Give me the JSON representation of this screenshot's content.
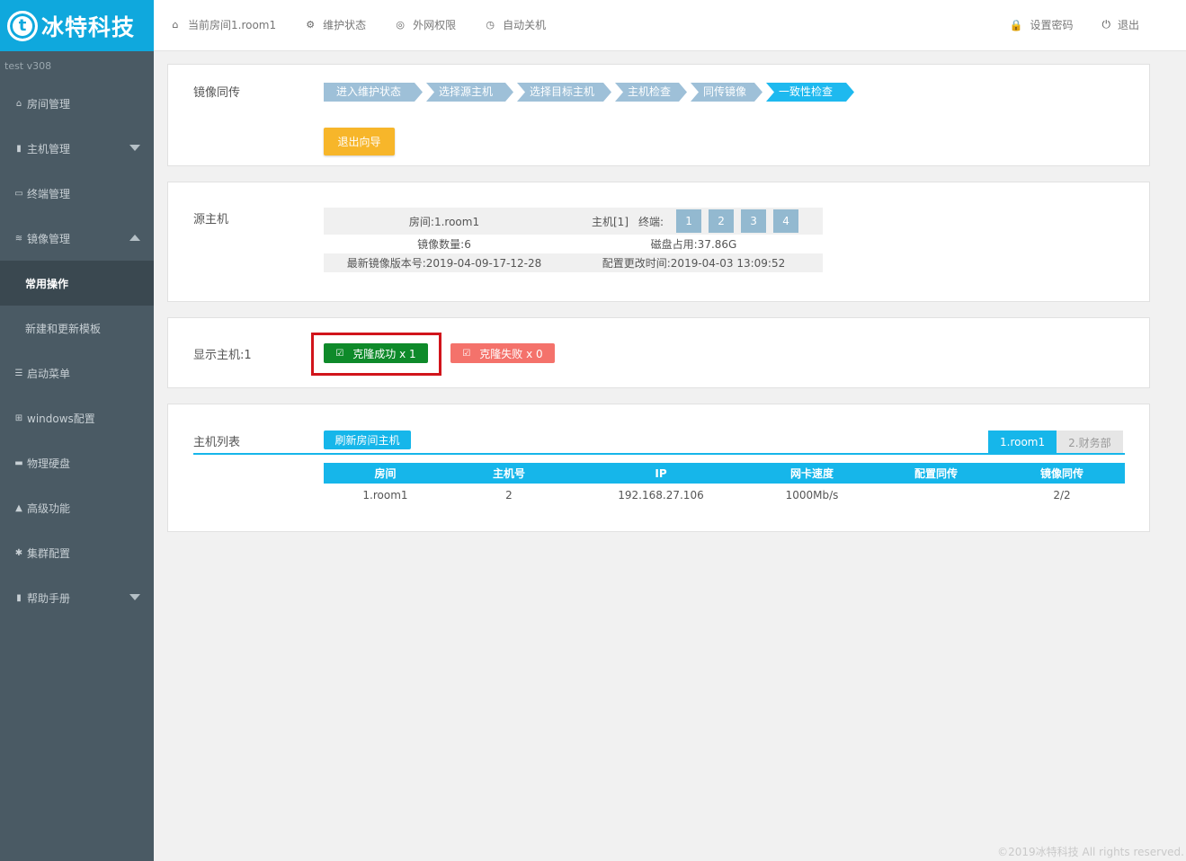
{
  "brand": {
    "logo_letter": "t",
    "name": "冰特科技"
  },
  "topnav": [
    {
      "icon": "home-icon",
      "glyph": "⌂",
      "label": "当前房间1.room1"
    },
    {
      "icon": "wrench-icon",
      "glyph": "⚙",
      "label": "维护状态"
    },
    {
      "icon": "globe-icon",
      "glyph": "◎",
      "label": "外网权限"
    },
    {
      "icon": "clock-icon",
      "glyph": "◷",
      "label": "自动关机"
    }
  ],
  "topright": [
    {
      "icon": "lock-icon",
      "glyph": "🔒",
      "label": "设置密码"
    },
    {
      "icon": "power-icon",
      "glyph": "⏻",
      "label": "退出"
    }
  ],
  "sidebar": {
    "version": "test  v308",
    "items": [
      {
        "label": "房间管理",
        "icon": "home-icon",
        "glyph": "⌂"
      },
      {
        "label": "主机管理",
        "icon": "server-icon",
        "glyph": "▮"
      },
      {
        "label": "终端管理",
        "icon": "monitor-icon",
        "glyph": "▭"
      },
      {
        "label": "镜像管理",
        "icon": "database-icon",
        "glyph": "≋"
      },
      {
        "label": "常用操作"
      },
      {
        "label": "新建和更新模板"
      },
      {
        "label": "启动菜单",
        "icon": "list-icon",
        "glyph": "☰"
      },
      {
        "label": "windows配置",
        "icon": "windows-icon",
        "glyph": "⊞"
      },
      {
        "label": "物理硬盘",
        "icon": "harddisk-icon",
        "glyph": "▬"
      },
      {
        "label": "高级功能",
        "icon": "warning-icon",
        "glyph": "▲"
      },
      {
        "label": "集群配置",
        "icon": "gear-icon",
        "glyph": "✱"
      },
      {
        "label": "帮助手册",
        "icon": "book-icon",
        "glyph": "▮"
      }
    ]
  },
  "wizard": {
    "title": "镜像同传",
    "steps": [
      "进入维护状态",
      "选择源主机",
      "选择目标主机",
      "主机检查",
      "同传镜像",
      "一致性检查"
    ],
    "exit_label": "退出向导"
  },
  "source": {
    "title": "源主机",
    "room": "房间:1.room1",
    "host": "主机[1]",
    "terminal_label": "终端:",
    "terminals": [
      "1",
      "2",
      "3",
      "4"
    ],
    "image_count": "镜像数量:6",
    "disk_used": "磁盘占用:37.86G",
    "latest_version": "最新镜像版本号:2019-04-09-17-12-28",
    "config_time": "配置更改时间:2019-04-03 13:09:52"
  },
  "result": {
    "title": "显示主机:1",
    "success_label": "克隆成功 x 1",
    "fail_label": "克隆失败 x 0"
  },
  "hostlist": {
    "title": "主机列表",
    "refresh_label": "刷新房间主机",
    "tabs": [
      "1.room1",
      "2.财务部"
    ],
    "columns": [
      "房间",
      "主机号",
      "IP",
      "网卡速度",
      "配置同传",
      "镜像同传"
    ],
    "rows": [
      [
        "1.room1",
        "2",
        "192.168.27.106",
        "1000Mb/s",
        "",
        "2/2"
      ]
    ]
  },
  "footer": "©2019冰特科技 All rights reserved."
}
